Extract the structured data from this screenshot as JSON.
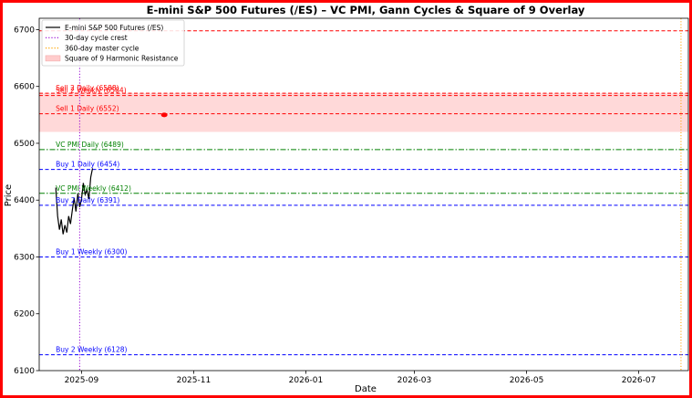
{
  "chart_data": {
    "type": "line",
    "title": "E-mini S&P 500 Futures (/ES) – VC PMI, Gann Cycles & Square of 9 Overlay",
    "xlabel": "Date",
    "ylabel": "Price",
    "xlim": [
      "2025-08-09",
      "2026-07-28"
    ],
    "ylim": [
      6100,
      6720
    ],
    "x_ticks": [
      "2025-09",
      "2025-11",
      "2026-01",
      "2026-03",
      "2026-05",
      "2026-07"
    ],
    "y_ticks": [
      6100,
      6200,
      6300,
      6400,
      6500,
      6600,
      6700
    ],
    "grid": false,
    "legend": {
      "placement": "top-left",
      "entries": [
        "E-mini S&P 500 Futures (/ES)",
        "30-day cycle crest",
        "360-day master cycle",
        "Square of 9 Harmonic Resistance"
      ]
    },
    "series": [
      {
        "name": "E-mini S&P 500 Futures (/ES)",
        "color": "#000000",
        "x": [
          "2025-08-18",
          "2025-08-19",
          "2025-08-20",
          "2025-08-21",
          "2025-08-22",
          "2025-08-23",
          "2025-08-24",
          "2025-08-25",
          "2025-08-26",
          "2025-08-27",
          "2025-08-28",
          "2025-08-29",
          "2025-08-30",
          "2025-08-31",
          "2025-09-01",
          "2025-09-02",
          "2025-09-03",
          "2025-09-04",
          "2025-09-05",
          "2025-09-06",
          "2025-09-07"
        ],
        "y": [
          6422,
          6372,
          6348,
          6366,
          6340,
          6356,
          6343,
          6372,
          6358,
          6382,
          6404,
          6380,
          6412,
          6388,
          6402,
          6430,
          6410,
          6418,
          6402,
          6440,
          6456
        ]
      }
    ],
    "levels": [
      {
        "label": "",
        "value": 6698,
        "color": "#ff0000",
        "style": "dashed"
      },
      {
        "label": "Sell 2 Daily (6588)",
        "value": 6588,
        "color": "#ff0000",
        "style": "dashed"
      },
      {
        "label": "Sell 2 Weekly (6584)",
        "value": 6584,
        "color": "#ff0000",
        "style": "dashed"
      },
      {
        "label": "Sell 1 Daily (6552)",
        "value": 6552,
        "color": "#ff0000",
        "style": "dashed"
      },
      {
        "label": "VC PMI Daily (6489)",
        "value": 6489,
        "color": "#008000",
        "style": "dashdot"
      },
      {
        "label": "Buy 1 Daily (6454)",
        "value": 6454,
        "color": "#0000ff",
        "style": "dashed"
      },
      {
        "label": "VC PMI Weekly (6412)",
        "value": 6412,
        "color": "#008000",
        "style": "dashdot"
      },
      {
        "label": "Buy 2 Daily (6391)",
        "value": 6391,
        "color": "#0000ff",
        "style": "dashed"
      },
      {
        "label": "Buy 1 Weekly (6300)",
        "value": 6300,
        "color": "#0000ff",
        "style": "dashed"
      },
      {
        "label": "Buy 2 Weekly (6128)",
        "value": 6128,
        "color": "#0000ff",
        "style": "dashed"
      }
    ],
    "band": {
      "name": "Square of 9 Harmonic Resistance",
      "low": 6520,
      "high": 6588,
      "color": "#ffcccc"
    },
    "cycle_lines": [
      {
        "name": "30-day cycle crest",
        "x": "2025-08-31",
        "color": "#9400d3"
      },
      {
        "name": "360-day master cycle",
        "x": "2026-07-24",
        "color": "#ffa500"
      }
    ],
    "point": {
      "x": "2025-10-16",
      "y": 6550,
      "color": "#ff0000"
    }
  }
}
